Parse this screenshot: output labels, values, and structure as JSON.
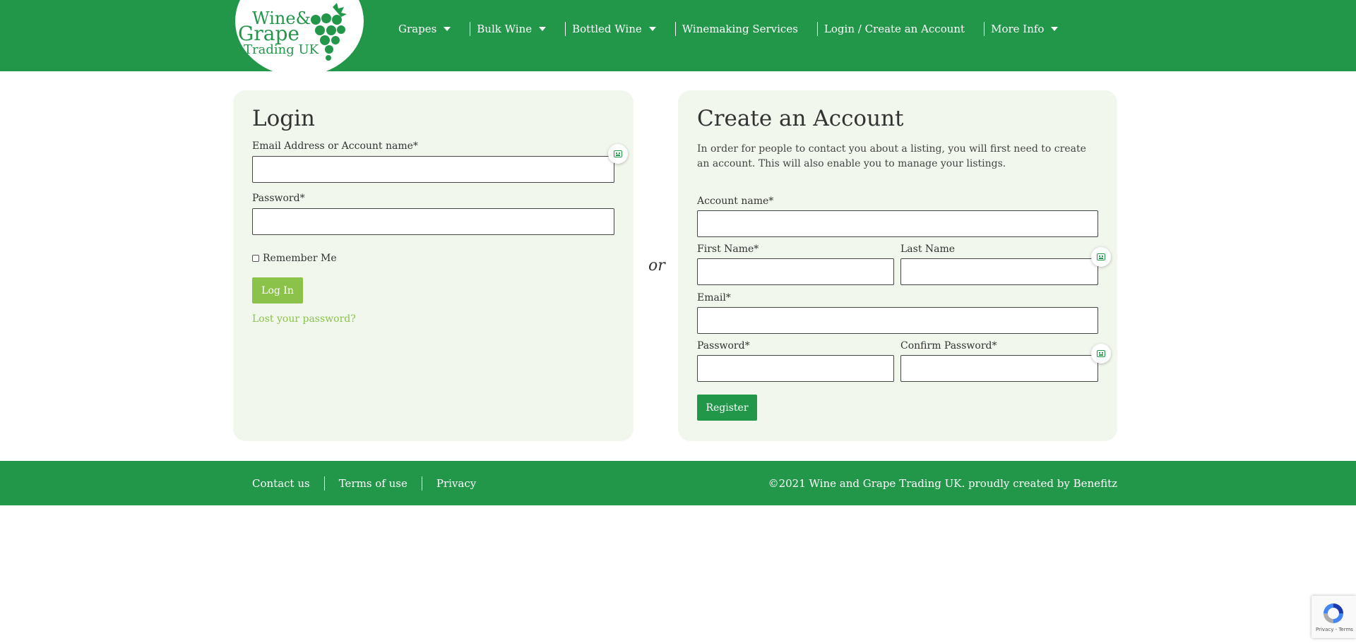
{
  "brand": {
    "line1": "Wine&",
    "line2": "Grape",
    "line3": "Trading UK",
    "color": "#22974a"
  },
  "nav": {
    "items": [
      {
        "label": "Grapes",
        "has_dropdown": true
      },
      {
        "label": "Bulk Wine",
        "has_dropdown": true
      },
      {
        "label": "Bottled Wine",
        "has_dropdown": true
      },
      {
        "label": "Winemaking Services",
        "has_dropdown": false
      },
      {
        "label": "Login / Create an Account",
        "has_dropdown": false
      },
      {
        "label": "More Info",
        "has_dropdown": true
      }
    ]
  },
  "login": {
    "title": "Login",
    "email_label": "Email Address or Account name*",
    "email_value": "",
    "password_label": "Password*",
    "password_value": "",
    "remember_label": "Remember Me",
    "remember_checked": false,
    "submit_label": "Log In",
    "lost_password_label": "Lost your password?"
  },
  "separator": "or",
  "register": {
    "title": "Create an Account",
    "intro": "In order for people to contact you about a listing, you will first need to create an account. This will also enable you to manage your listings.",
    "account_label": "Account name*",
    "first_name_label": "First Name*",
    "last_name_label": "Last Name",
    "email_label": "Email*",
    "password_label": "Password*",
    "confirm_password_label": "Confirm Password*",
    "submit_label": "Register"
  },
  "footer": {
    "links": [
      "Contact us",
      "Terms of use",
      "Privacy"
    ],
    "copyright": "©2021 Wine and Grape Trading UK. proudly created by Benefitz"
  },
  "recaptcha": {
    "text": "Privacy - Terms"
  },
  "colors": {
    "primary_green": "#22974a",
    "light_green": "#8bc34a",
    "panel_bg": "#f1f7ec"
  }
}
